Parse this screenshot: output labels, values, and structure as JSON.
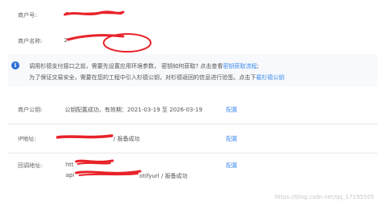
{
  "merchant": {
    "id_label": "商户号:",
    "name_label": "商户名称:",
    "name_partial": "2"
  },
  "notice": {
    "icon": "info-icon",
    "line1_text": "调用杉德支付接口之前，需要先设置应用环境参数，  密钥如何获取? 点击查看",
    "line1_link": "密钥获取流程",
    "line1_tail": ";",
    "line2_text": "为了保证交易安全，需要在您的工程中引入杉德公钥，对杉德返回的信息进行验签。点击下",
    "line2_link": "载杉德公钥"
  },
  "public_key": {
    "label": "商户公钥:",
    "status": "公钥配置成功，有效期：2021-03-19 至 2026-03-19",
    "action": "配置"
  },
  "ip_address": {
    "label": "IP地址:",
    "status": "/ 报备成功",
    "action": "配置"
  },
  "callback": {
    "label": "回调地址:",
    "line1_prefix": "htt",
    "line2_prefix": "api",
    "line2_mid": "otifyurl",
    "line2_status": "/ 报备成功",
    "action": "配置"
  },
  "watermark": "https://blog.csdn.net/qq_17195505",
  "colors": {
    "link": "#3d8bf0",
    "info_icon": "#2f6fd6",
    "redaction": "#e8222a",
    "notice_bg": "#f7f9fc"
  }
}
